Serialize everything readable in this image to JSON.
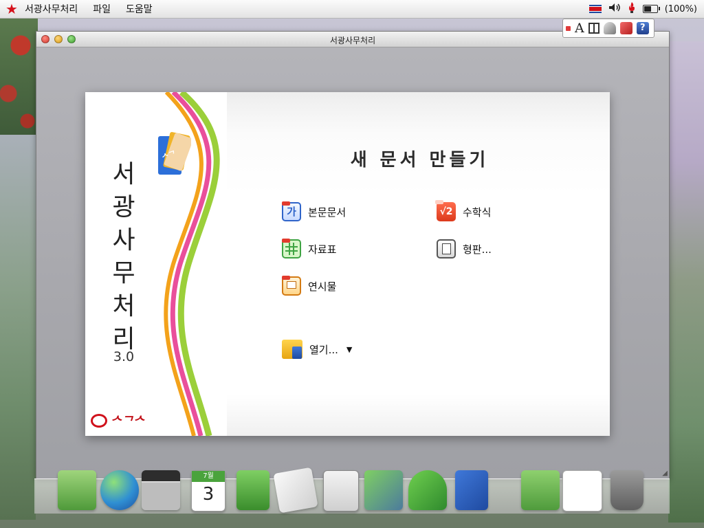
{
  "menubar": {
    "app_name": "서광사무처리",
    "menus": [
      "파일",
      "도움말"
    ],
    "battery_text": "(100%)"
  },
  "window": {
    "title": "서광사무처리"
  },
  "welcome": {
    "brand_chars": [
      "서",
      "광",
      "사",
      "무",
      "처",
      "리"
    ],
    "version": "3.0",
    "heading": "새 문서 만들기",
    "footer_logo_text": "ᄉᄀᄉ",
    "actions": {
      "document": "본문문서",
      "math": "수학식",
      "spreadsheet": "자료표",
      "template": "형판...",
      "presentation": "연시물",
      "open": "열기..."
    },
    "icon_texts": {
      "document": "가",
      "math": "√2"
    }
  },
  "dock": {
    "calendar_month": "7월",
    "calendar_day": "3"
  },
  "icons": {
    "tray": [
      "flag-icon",
      "volume-icon",
      "torch-icon",
      "battery-icon"
    ],
    "ime": [
      "ime-status-icon",
      "font-icon",
      "layout-icon",
      "brush-icon",
      "tool-icon",
      "help-icon"
    ],
    "dock": [
      "notes-icon",
      "globe-icon",
      "video-icon",
      "calendar-icon",
      "contacts-icon",
      "search-icon",
      "calculator-icon",
      "system-tools-icon",
      "info-icon",
      "office-icon",
      "folder-icon",
      "document-icon",
      "trash-icon"
    ]
  },
  "colors": {
    "star": "#d6111b",
    "brand_red": "#c21119"
  }
}
